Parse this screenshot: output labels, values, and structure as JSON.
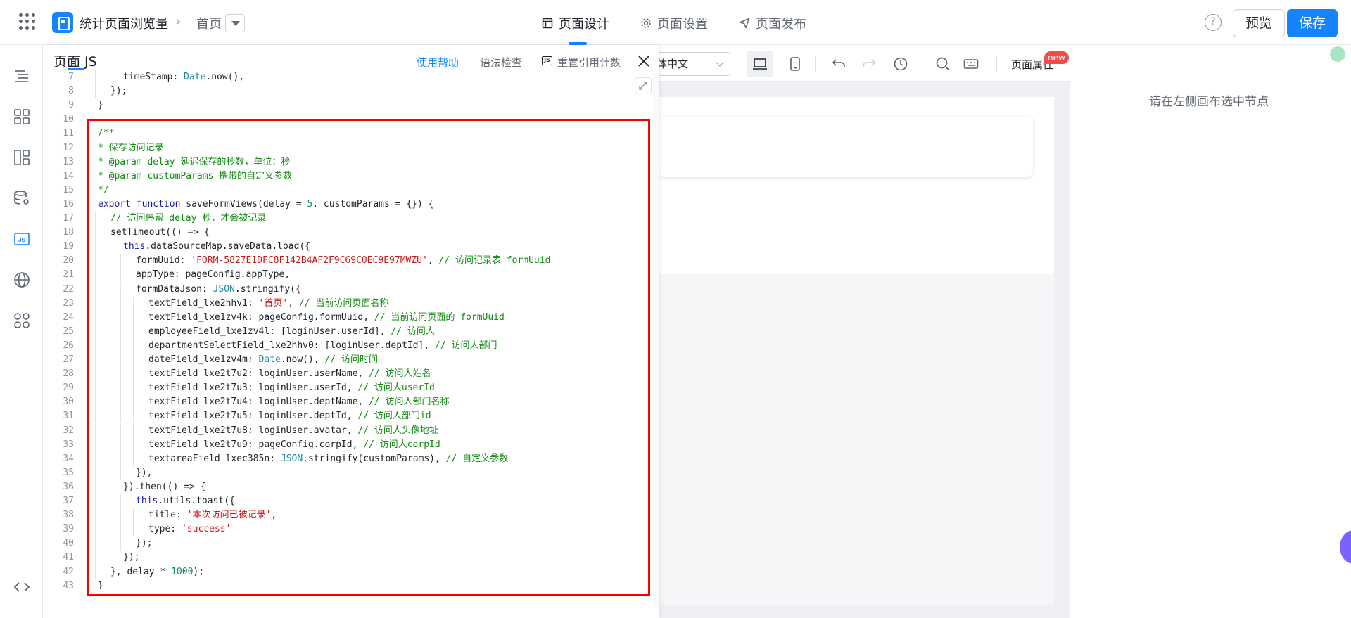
{
  "header": {
    "app_name": "统计页面浏览量",
    "crumb_sep": "›",
    "page_name": "首页",
    "tabs": [
      {
        "label": "页面设计",
        "icon": "layout-icon",
        "active": true
      },
      {
        "label": "页面设置",
        "icon": "gear-icon",
        "active": false
      },
      {
        "label": "页面发布",
        "icon": "send-icon",
        "active": false
      }
    ],
    "help": "?",
    "preview_label": "预览",
    "save_label": "保存"
  },
  "canvas": {
    "lang_select": "体中文",
    "page_attr_label": "页面属性",
    "new_badge": "new"
  },
  "right_panel": {
    "hint": "请在左侧画布选中节点"
  },
  "js_panel": {
    "title": "页面 JS",
    "help_link": "使用帮助",
    "lint_link": "语法检查",
    "reset_link": "重置引用计数",
    "js_badge": "JS"
  },
  "colors": {
    "accent": "#1684fc",
    "highlight_box": "#ff0000",
    "comment": "#108a10",
    "string": "#c41a16",
    "keyword": "#1a1aa6"
  },
  "code": {
    "lines": [
      {
        "n": "7",
        "indent": 2,
        "parts": [
          {
            "t": "timeStamp: "
          },
          {
            "t": "Date",
            "c": "bi"
          },
          {
            "t": ".now(),"
          }
        ]
      },
      {
        "n": "8",
        "indent": 1,
        "parts": [
          {
            "t": "});"
          }
        ]
      },
      {
        "n": "9",
        "indent": 0,
        "parts": [
          {
            "t": "}"
          }
        ]
      },
      {
        "n": "10",
        "indent": 0,
        "parts": []
      },
      {
        "n": "11",
        "indent": 0,
        "parts": [
          {
            "t": "/**",
            "c": "cm"
          }
        ]
      },
      {
        "n": "12",
        "indent": 0,
        "parts": [
          {
            "t": "* 保存访问记录",
            "c": "cm"
          }
        ]
      },
      {
        "n": "13",
        "indent": 0,
        "parts": [
          {
            "t": "* @param delay 延迟保存的秒数，单位：秒",
            "c": "cm"
          }
        ]
      },
      {
        "n": "14",
        "indent": 0,
        "parts": [
          {
            "t": "* @param customParams 携带的自定义参数",
            "c": "cm"
          }
        ]
      },
      {
        "n": "15",
        "indent": 0,
        "parts": [
          {
            "t": "*/",
            "c": "cm"
          }
        ]
      },
      {
        "n": "16",
        "indent": 0,
        "parts": [
          {
            "t": "export ",
            "c": "kw"
          },
          {
            "t": "function ",
            "c": "kw"
          },
          {
            "t": "saveFormViews(delay = "
          },
          {
            "t": "5",
            "c": "num"
          },
          {
            "t": ", customParams = {}) {"
          }
        ]
      },
      {
        "n": "17",
        "indent": 1,
        "parts": [
          {
            "t": "// 访问停留 delay 秒，才会被记录",
            "c": "cm"
          }
        ]
      },
      {
        "n": "18",
        "indent": 1,
        "parts": [
          {
            "t": "setTimeout(() => {"
          }
        ]
      },
      {
        "n": "19",
        "indent": 2,
        "parts": [
          {
            "t": "this",
            "c": "kw"
          },
          {
            "t": ".dataSourceMap.saveData.load({"
          }
        ]
      },
      {
        "n": "20",
        "indent": 3,
        "parts": [
          {
            "t": "formUuid: "
          },
          {
            "t": "'FORM-5827E1DFC8F142B4AF2F9C69C0EC9E97MWZU'",
            "c": "str"
          },
          {
            "t": ", "
          },
          {
            "t": "// 访问记录表 formUuid",
            "c": "cm"
          }
        ]
      },
      {
        "n": "21",
        "indent": 3,
        "parts": [
          {
            "t": "appType: pageConfig.appType,"
          }
        ]
      },
      {
        "n": "22",
        "indent": 3,
        "parts": [
          {
            "t": "formDataJson: "
          },
          {
            "t": "JSON",
            "c": "bi"
          },
          {
            "t": ".stringify({"
          }
        ]
      },
      {
        "n": "23",
        "indent": 4,
        "parts": [
          {
            "t": "textField_lxe2hhv1: "
          },
          {
            "t": "'首页'",
            "c": "str"
          },
          {
            "t": ", "
          },
          {
            "t": "// 当前访问页面名称",
            "c": "cm"
          }
        ]
      },
      {
        "n": "24",
        "indent": 4,
        "parts": [
          {
            "t": "textField_lxe1zv4k: pageConfig.formUuid, "
          },
          {
            "t": "// 当前访问页面的 formUuid",
            "c": "cm"
          }
        ]
      },
      {
        "n": "25",
        "indent": 4,
        "parts": [
          {
            "t": "employeeField_lxe1zv4l: [loginUser.userId], "
          },
          {
            "t": "// 访问人",
            "c": "cm"
          }
        ]
      },
      {
        "n": "26",
        "indent": 4,
        "parts": [
          {
            "t": "departmentSelectField_lxe2hhv0: [loginUser.deptId], "
          },
          {
            "t": "// 访问人部门",
            "c": "cm"
          }
        ]
      },
      {
        "n": "27",
        "indent": 4,
        "parts": [
          {
            "t": "dateField_lxe1zv4m: "
          },
          {
            "t": "Date",
            "c": "bi"
          },
          {
            "t": ".now(), "
          },
          {
            "t": "// 访问时间",
            "c": "cm"
          }
        ]
      },
      {
        "n": "28",
        "indent": 4,
        "parts": [
          {
            "t": "textField_lxe2t7u2: loginUser.userName, "
          },
          {
            "t": "// 访问人姓名",
            "c": "cm"
          }
        ]
      },
      {
        "n": "29",
        "indent": 4,
        "parts": [
          {
            "t": "textField_lxe2t7u3: loginUser.userId, "
          },
          {
            "t": "// 访问人userId",
            "c": "cm"
          }
        ]
      },
      {
        "n": "30",
        "indent": 4,
        "parts": [
          {
            "t": "textField_lxe2t7u4: loginUser.deptName, "
          },
          {
            "t": "// 访问人部门名称",
            "c": "cm"
          }
        ]
      },
      {
        "n": "31",
        "indent": 4,
        "parts": [
          {
            "t": "textField_lxe2t7u5: loginUser.deptId, "
          },
          {
            "t": "// 访问人部门id",
            "c": "cm"
          }
        ]
      },
      {
        "n": "32",
        "indent": 4,
        "parts": [
          {
            "t": "textField_lxe2t7u8: loginUser.avatar, "
          },
          {
            "t": "// 访问人头像地址",
            "c": "cm"
          }
        ]
      },
      {
        "n": "33",
        "indent": 4,
        "parts": [
          {
            "t": "textField_lxe2t7u9: pageConfig.corpId, "
          },
          {
            "t": "// 访问人corpId",
            "c": "cm"
          }
        ]
      },
      {
        "n": "34",
        "indent": 4,
        "parts": [
          {
            "t": "textareaField_lxec385n: "
          },
          {
            "t": "JSON",
            "c": "bi"
          },
          {
            "t": ".stringify(customParams), "
          },
          {
            "t": "// 自定义参数",
            "c": "cm"
          }
        ]
      },
      {
        "n": "35",
        "indent": 3,
        "parts": [
          {
            "t": "}),"
          }
        ]
      },
      {
        "n": "36",
        "indent": 2,
        "parts": [
          {
            "t": "}).then(() => {"
          }
        ]
      },
      {
        "n": "37",
        "indent": 3,
        "parts": [
          {
            "t": "this",
            "c": "kw"
          },
          {
            "t": ".utils.toast({"
          }
        ]
      },
      {
        "n": "38",
        "indent": 4,
        "parts": [
          {
            "t": "title: "
          },
          {
            "t": "'本次访问已被记录'",
            "c": "str"
          },
          {
            "t": ","
          }
        ]
      },
      {
        "n": "39",
        "indent": 4,
        "parts": [
          {
            "t": "type: "
          },
          {
            "t": "'success'",
            "c": "str"
          }
        ]
      },
      {
        "n": "40",
        "indent": 3,
        "parts": [
          {
            "t": "});"
          }
        ]
      },
      {
        "n": "41",
        "indent": 2,
        "parts": [
          {
            "t": "});"
          }
        ]
      },
      {
        "n": "42",
        "indent": 1,
        "parts": [
          {
            "t": "}, delay * "
          },
          {
            "t": "1000",
            "c": "num"
          },
          {
            "t": ");"
          }
        ]
      },
      {
        "n": "43",
        "indent": 0,
        "parts": [
          {
            "t": "}"
          }
        ]
      }
    ]
  }
}
